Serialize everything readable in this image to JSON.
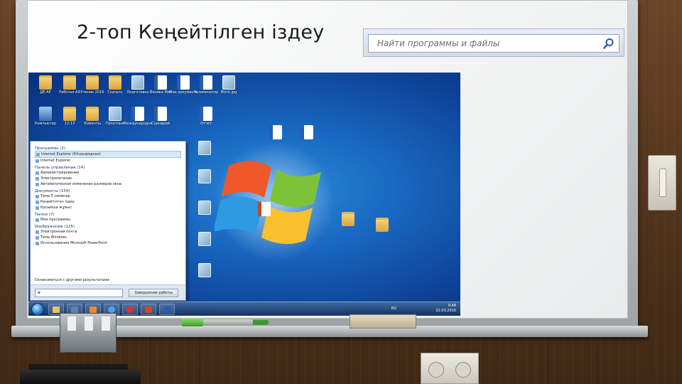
{
  "slide": {
    "title": "2-топ Кеңейтілген іздеу"
  },
  "search": {
    "placeholder": "Найти программы и файлы"
  },
  "desktop_icons": [
    {
      "label": "ДЕ-АР",
      "type": "folder"
    },
    {
      "label": "Рабочая АЯ",
      "type": "folder"
    },
    {
      "label": "Ученик 2016",
      "type": "folder"
    },
    {
      "label": "Скачать",
      "type": "folder"
    },
    {
      "label": "Подготовка",
      "type": "img"
    },
    {
      "label": "Физика Мос",
      "type": "doc"
    },
    {
      "label": "Мои документы",
      "type": "doc"
    },
    {
      "label": "Экзаменатор",
      "type": "doc"
    },
    {
      "label": "Фото.jpg",
      "type": "img"
    },
    {
      "label": "Компьютер",
      "type": "comp"
    },
    {
      "label": "12-13",
      "type": "folder"
    },
    {
      "label": "Коменты",
      "type": "folder"
    },
    {
      "label": "Печатные",
      "type": "img"
    },
    {
      "label": "Международная",
      "type": "doc"
    },
    {
      "label": "Сценарий",
      "type": "doc"
    },
    {
      "label": "Отчет",
      "type": "doc"
    }
  ],
  "start_menu": {
    "groups": [
      {
        "title": "Программы (2)",
        "items": [
          "Internet Explorer (64-разрядная)",
          "Internet Explorer"
        ]
      },
      {
        "title": "Панель управления (14)",
        "items": [
          "Администрирование",
          "Электропитание",
          "Автоматическое изменение размеров окна"
        ]
      },
      {
        "title": "Документы (154)",
        "items": [
          "Тема 5 семинар",
          "Кеңейтілген іздеу",
          "Қосымша жұмыс"
        ]
      },
      {
        "title": "Папки (7)",
        "items": [
          "Мои программы"
        ]
      },
      {
        "title": "Изображения (125)",
        "items": [
          "Электронная почта",
          "Тема Windows",
          "Использование Microsoft PowerPoint"
        ]
      }
    ],
    "more_results": "Ознакомиться с другими результатами",
    "search_value": "ә",
    "shutdown_label": "Завершение работы"
  },
  "taskbar": {
    "language": "RU",
    "time": "9:48",
    "date": "22.03.2016"
  },
  "colors": {
    "board": "#ffffff",
    "desktop_blue": "#1866c0",
    "marker_green": "#3f9a2a"
  }
}
